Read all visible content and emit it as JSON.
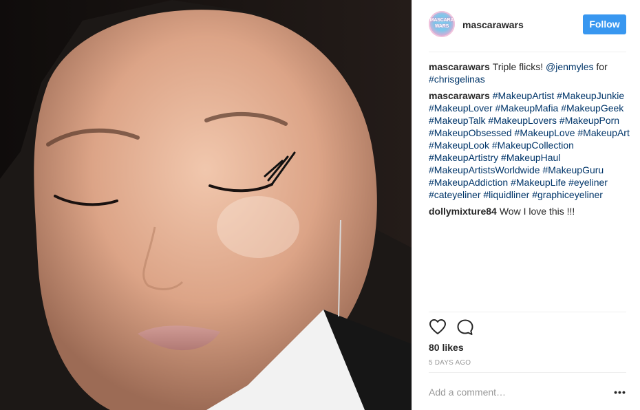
{
  "post": {
    "username": "mascarawars",
    "avatar_label": "MASCARA WARS",
    "follow_label": "Follow",
    "comments": [
      {
        "author": "mascarawars",
        "parts": [
          {
            "t": "text",
            "v": "Triple flicks! "
          },
          {
            "t": "tag",
            "v": "@jenmyles"
          },
          {
            "t": "text",
            "v": " for "
          },
          {
            "t": "tag",
            "v": "#chrisgelinas"
          }
        ]
      },
      {
        "author": "mascarawars",
        "parts": [
          {
            "t": "tag",
            "v": "#MakeupArtist"
          },
          {
            "t": "text",
            "v": " "
          },
          {
            "t": "tag",
            "v": "#MakeupJunkie"
          },
          {
            "t": "text",
            "v": " "
          },
          {
            "t": "tag",
            "v": "#MakeupLover"
          },
          {
            "t": "text",
            "v": " "
          },
          {
            "t": "tag",
            "v": "#MakeupMafia"
          },
          {
            "t": "text",
            "v": " "
          },
          {
            "t": "tag",
            "v": "#MakeupGeek"
          },
          {
            "t": "text",
            "v": " "
          },
          {
            "t": "tag",
            "v": "#MakeupTalk"
          },
          {
            "t": "text",
            "v": " "
          },
          {
            "t": "tag",
            "v": "#MakeupLovers"
          },
          {
            "t": "text",
            "v": " "
          },
          {
            "t": "tag",
            "v": "#MakeupPorn"
          },
          {
            "t": "text",
            "v": " "
          },
          {
            "t": "tag",
            "v": "#MakeupObsessed"
          },
          {
            "t": "text",
            "v": " "
          },
          {
            "t": "tag",
            "v": "#MakeupLove"
          },
          {
            "t": "text",
            "v": " "
          },
          {
            "t": "tag",
            "v": "#MakeupArt"
          },
          {
            "t": "text",
            "v": " "
          },
          {
            "t": "tag",
            "v": "#MakeupLook"
          },
          {
            "t": "text",
            "v": " "
          },
          {
            "t": "tag",
            "v": "#MakeupCollection"
          },
          {
            "t": "text",
            "v": " "
          },
          {
            "t": "tag",
            "v": "#MakeupArtistry"
          },
          {
            "t": "text",
            "v": " "
          },
          {
            "t": "tag",
            "v": "#MakeupHaul"
          },
          {
            "t": "text",
            "v": " "
          },
          {
            "t": "tag",
            "v": "#MakeupArtistsWorldwide"
          },
          {
            "t": "text",
            "v": " "
          },
          {
            "t": "tag",
            "v": "#MakeupGuru"
          },
          {
            "t": "text",
            "v": " "
          },
          {
            "t": "tag",
            "v": "#MakeupAddiction"
          },
          {
            "t": "text",
            "v": " "
          },
          {
            "t": "tag",
            "v": "#MakeupLife"
          },
          {
            "t": "text",
            "v": " "
          },
          {
            "t": "tag",
            "v": "#eyeliner"
          },
          {
            "t": "text",
            "v": " "
          },
          {
            "t": "tag",
            "v": "#cateyeliner"
          },
          {
            "t": "text",
            "v": " "
          },
          {
            "t": "tag",
            "v": "#liquidliner"
          },
          {
            "t": "text",
            "v": " "
          },
          {
            "t": "tag",
            "v": "#graphiceyeliner"
          }
        ]
      },
      {
        "author": "dollymixture84",
        "parts": [
          {
            "t": "text",
            "v": "Wow I love this !!!"
          }
        ]
      }
    ],
    "actions": {
      "like_icon": "heart-outline-icon",
      "comment_icon": "speech-bubble-icon"
    },
    "likes": "80 likes",
    "timestamp": "5 DAYS AGO",
    "comment_placeholder": "Add a comment…",
    "more_label": "•••"
  },
  "colors": {
    "follow_button": "#3897f0",
    "hashtag": "#003569",
    "muted": "#999999",
    "text": "#262626"
  }
}
